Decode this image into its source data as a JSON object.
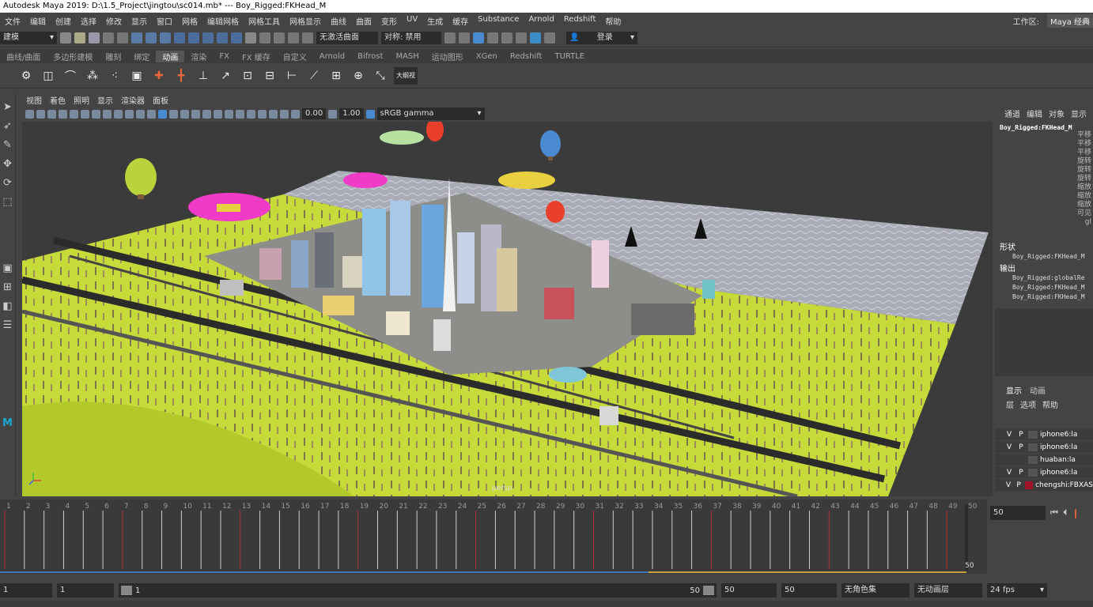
{
  "title_bar": {
    "text": "Autodesk Maya 2019: D:\\1.5_Project\\jingtou\\sc014.mb*  ---  Boy_Rigged:FKHead_M"
  },
  "menu": {
    "items": [
      "文件",
      "编辑",
      "创建",
      "选择",
      "修改",
      "显示",
      "窗口",
      "网格",
      "编辑网格",
      "网格工具",
      "网格显示",
      "曲线",
      "曲面",
      "变形",
      "UV",
      "生成",
      "缓存",
      "Substance",
      "Arnold",
      "Redshift",
      "帮助"
    ],
    "workspace_label": "工作区:",
    "workspace_value": "Maya 经典"
  },
  "status_line": {
    "mode": "建模",
    "live_surface": "无激活曲面",
    "symmetry": "对称: 禁用",
    "login": "登录"
  },
  "shelf_tabs": [
    "曲线/曲面",
    "多边形建模",
    "雕刻",
    "绑定",
    "动画",
    "渲染",
    "FX",
    "FX 缓存",
    "自定义",
    "Arnold",
    "Bifrost",
    "MASH",
    "运动图形",
    "XGen",
    "Redshift",
    "TURTLE"
  ],
  "shelf_active": "动画",
  "shelf_icon_label": "大纲视",
  "viewport": {
    "menu": [
      "视图",
      "着色",
      "照明",
      "显示",
      "渲染器",
      "面板"
    ],
    "exposure": "0.00",
    "gamma": "1.00",
    "color_space": "sRGB gamma",
    "camera_label": "persp"
  },
  "channel_box": {
    "tabs": [
      "通道",
      "编辑",
      "对象",
      "显示"
    ],
    "node": "Boy_Rigged:FKHead_M",
    "attrs": [
      "平移",
      "平移",
      "平移",
      "旋转",
      "旋转",
      "旋转",
      "缩放",
      "缩放",
      "缩放",
      "可见",
      "gl"
    ],
    "shapes_label": "形状",
    "shapes_node": "Boy_Rigged:FKHead_M",
    "outputs_label": "输出",
    "outputs": [
      "Boy_Rigged:globalRe",
      "Boy_Rigged:FKHead_M",
      "Boy_Rigged:FKHead_M"
    ]
  },
  "layer_editor": {
    "tabs": [
      "显示",
      "动画"
    ],
    "menu": [
      "层",
      "选项",
      "帮助"
    ],
    "layers": [
      {
        "v": "V",
        "p": "P",
        "name": "iphone6:la",
        "color": "#555555"
      },
      {
        "v": "V",
        "p": "P",
        "name": "iphone6:la",
        "color": "#555555"
      },
      {
        "v": "",
        "p": "",
        "name": "huaban:la",
        "color": "#555555"
      },
      {
        "v": "V",
        "p": "P",
        "name": "iphone6:la",
        "color": "#555555"
      },
      {
        "v": "V",
        "p": "P",
        "name": "chengshi:FBXAS",
        "color": "#a0142a"
      }
    ]
  },
  "timeline": {
    "ticks": [
      "1",
      "2",
      "3",
      "4",
      "5",
      "6",
      "7",
      "8",
      "9",
      "10",
      "11",
      "12",
      "13",
      "14",
      "15",
      "16",
      "17",
      "18",
      "19",
      "20",
      "21",
      "22",
      "23",
      "24",
      "25",
      "26",
      "27",
      "28",
      "29",
      "30",
      "31",
      "32",
      "33",
      "34",
      "35",
      "36",
      "37",
      "38",
      "39",
      "40",
      "41",
      "42",
      "43",
      "44",
      "45",
      "46",
      "47",
      "48",
      "49",
      "50"
    ],
    "end_label": "50",
    "current_frame": "50"
  },
  "range_slider": {
    "start": "1",
    "playback_start": "1",
    "slider_start_label": "1",
    "slider_end_label": "50",
    "playback_end": "50",
    "end": "50",
    "char_set": "无角色集",
    "anim_layer": "无动画层",
    "fps": "24 fps"
  }
}
